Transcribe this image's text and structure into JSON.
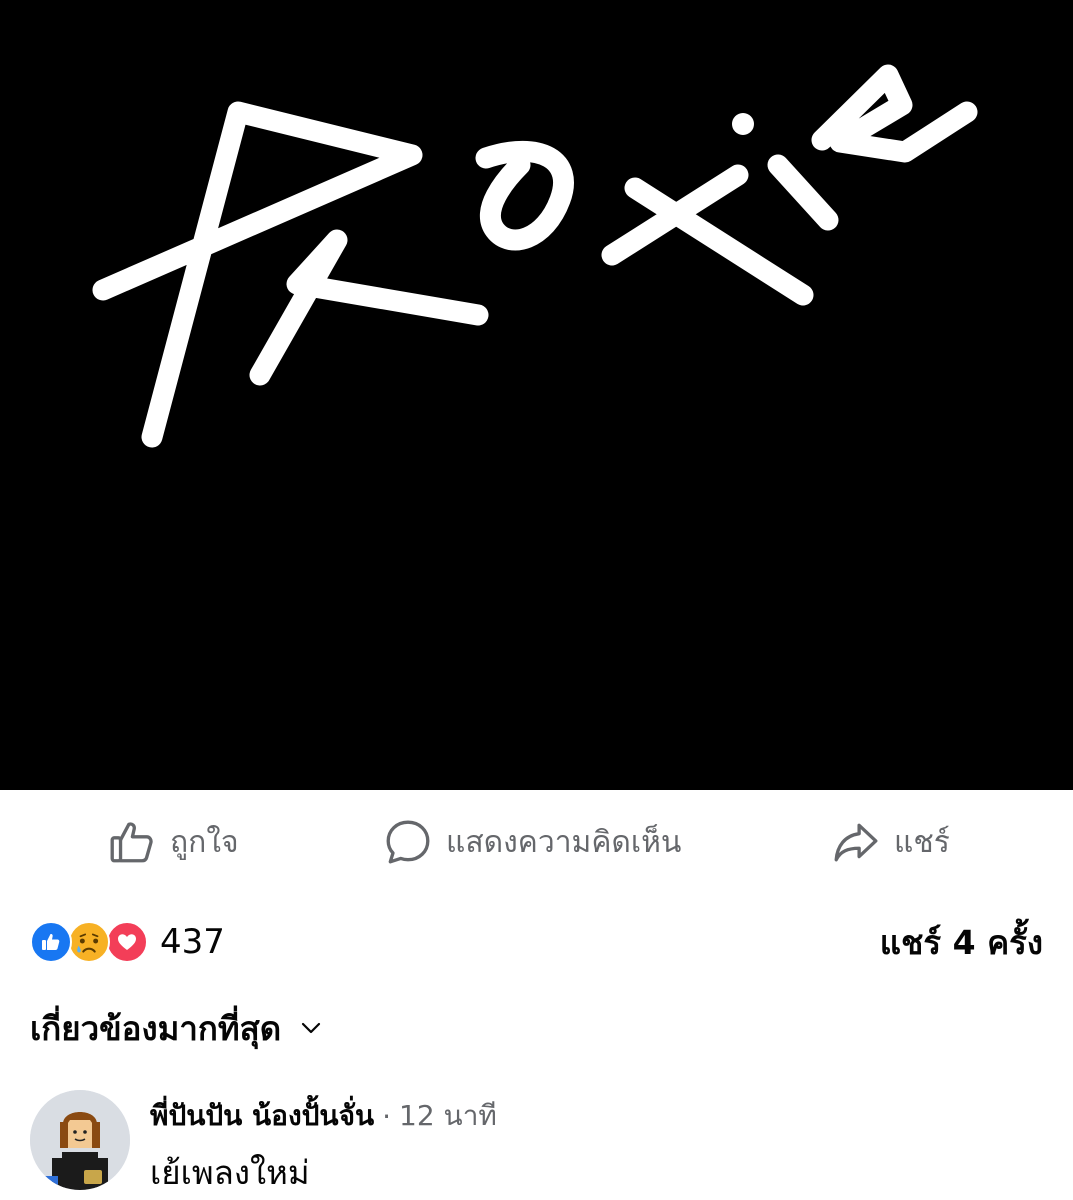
{
  "post": {
    "image": {
      "logo_text": "Proxie",
      "background_color": "#000000",
      "stroke_color": "#ffffff"
    }
  },
  "actions": {
    "like": {
      "label": "ถูกใจ",
      "icon": "thumbs-up-icon"
    },
    "comment": {
      "label": "แสดงความคิดเห็น",
      "icon": "speech-bubble-icon"
    },
    "share": {
      "label": "แชร์",
      "icon": "share-arrow-icon"
    }
  },
  "stats": {
    "reaction_icons": [
      "like-reaction-icon",
      "sad-reaction-icon",
      "love-reaction-icon"
    ],
    "reaction_count": "437",
    "share_count": "แชร์ 4 ครั้ง"
  },
  "comments_sort": {
    "label": "เกี่ยวข้องมากที่สุด",
    "icon": "chevron-down-icon"
  },
  "comments": [
    {
      "author": "พี่ปันปัน น้องปั้นจั่น",
      "separator": "·",
      "time": "12 นาที",
      "text": "เย้เพลงใหม่"
    }
  ],
  "colors": {
    "accent_blue": "#1877f2",
    "secondary_text": "#65676b",
    "love_red": "#f33e58",
    "sad_yellow": "#f7b125"
  }
}
